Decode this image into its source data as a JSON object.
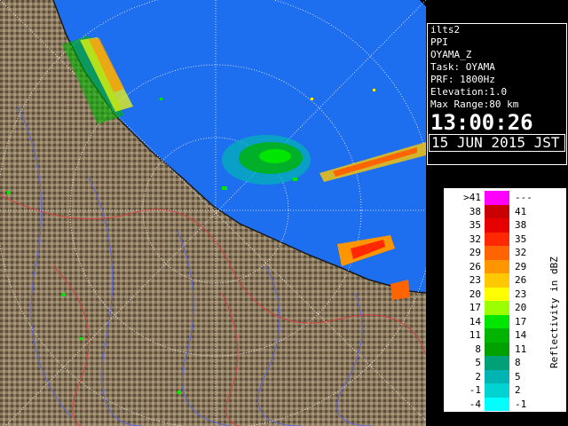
{
  "info": {
    "lines": [
      "ilts2",
      "PPI",
      "OYAMA_Z",
      "Task: OYAMA",
      "PRF: 1800Hz",
      "Elevation:1.0",
      "Max Range:80 km"
    ],
    "time": "13:00:26",
    "date": "15 JUN 2015 JST"
  },
  "legend": {
    "title": "Reflectivity in dBZ",
    "rows": [
      {
        "lo": ">41",
        "hi": "---",
        "color": "#ff00ff"
      },
      {
        "lo": "38",
        "hi": "41",
        "color": "#c80000"
      },
      {
        "lo": "35",
        "hi": "38",
        "color": "#e60000"
      },
      {
        "lo": "32",
        "hi": "35",
        "color": "#ff2800"
      },
      {
        "lo": "29",
        "hi": "32",
        "color": "#ff6400"
      },
      {
        "lo": "26",
        "hi": "29",
        "color": "#ff9600"
      },
      {
        "lo": "23",
        "hi": "26",
        "color": "#ffc800"
      },
      {
        "lo": "20",
        "hi": "23",
        "color": "#ffff00"
      },
      {
        "lo": "17",
        "hi": "20",
        "color": "#9bff00"
      },
      {
        "lo": "14",
        "hi": "17",
        "color": "#00e600"
      },
      {
        "lo": "11",
        "hi": "14",
        "color": "#00b400"
      },
      {
        "lo": "8",
        "hi": "11",
        "color": "#00a000"
      },
      {
        "lo": "5",
        "hi": "8",
        "color": "#00a078"
      },
      {
        "lo": "2",
        "hi": "5",
        "color": "#00b4b4"
      },
      {
        "lo": "-1",
        "hi": "2",
        "color": "#00d2d2"
      },
      {
        "lo": "-4",
        "hi": "-1",
        "color": "#00ffff"
      }
    ]
  },
  "map": {
    "sea_color": "#1e6ef0",
    "land_color": "#8c7a5e",
    "outside_color": "#000000",
    "range_ring_color": "#ffffff"
  }
}
